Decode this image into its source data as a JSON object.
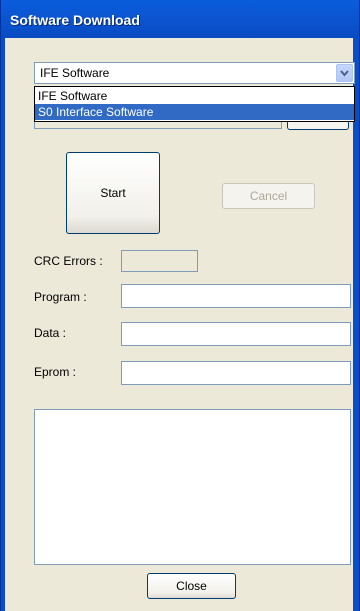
{
  "window": {
    "title": "Software Download"
  },
  "software_select": {
    "value": "IFE Software",
    "options": [
      "IFE Software",
      "S0 Interface Software"
    ],
    "highlighted_option": "S0 Interface Software",
    "icon": "chevron-down-icon"
  },
  "buttons": {
    "start_label": "Start",
    "cancel_label": "Cancel",
    "cancel_enabled": false,
    "close_label": "Close"
  },
  "fields": {
    "crc_errors_label": "CRC Errors :",
    "crc_errors_value": "",
    "program_label": "Program :",
    "program_value": "",
    "data_label": "Data :",
    "data_value": "",
    "eprom_label": "Eprom :",
    "eprom_value": ""
  },
  "log": {
    "text": ""
  },
  "colors": {
    "title_bar": "#0a4ec7",
    "dialog_background": "#ece9d8",
    "selection_highlight": "#316ac5",
    "disabled_text": "#aca899"
  }
}
